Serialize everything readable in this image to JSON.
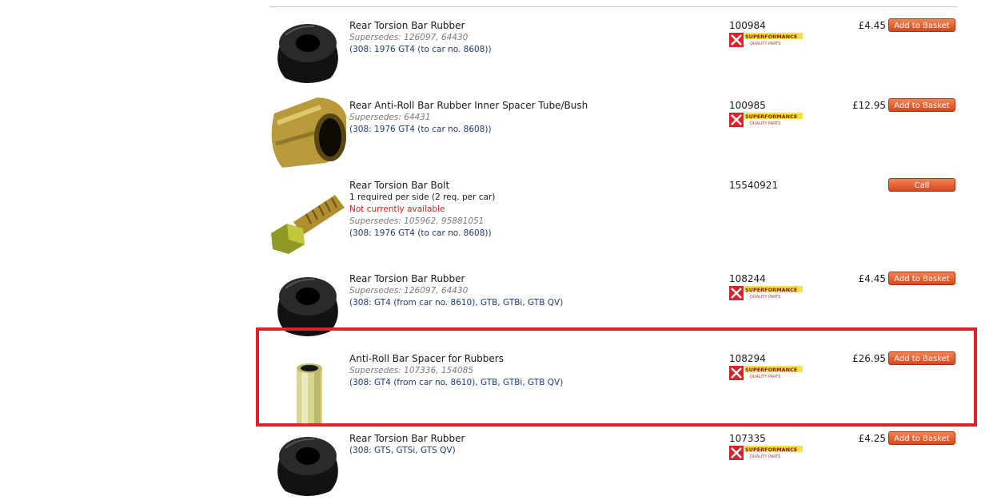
{
  "colors": {
    "accent_button": "#e05a26",
    "highlight_border": "#e2202a",
    "link": "#1f3a78",
    "unavailable": "#d31f1f"
  },
  "brand_logo": {
    "name": "SUPERFORMANCE",
    "tagline": "QUALITY PARTS"
  },
  "rows": [
    {
      "title": "Rear Torsion Bar Rubber",
      "image": "black-rubber-bushing",
      "supersedes": "Supersedes: 126097, 64430",
      "fitment": "(308: 1976 GT4 (to car no. 8608))",
      "part_no": "100984",
      "price": "£4.45",
      "button": "Add to Basket"
    },
    {
      "title": "Rear Anti-Roll Bar Rubber Inner Spacer Tube/Bush",
      "image": "brass-spacer-tube",
      "supersedes": "Supersedes: 64431",
      "fitment": "(308: 1976 GT4 (to car no. 8608))",
      "part_no": "100985",
      "price": "£12.95",
      "button": "Add to Basket"
    },
    {
      "title": "Rear Torsion Bar Bolt",
      "image": "hex-bolt",
      "note": "1 required per side (2 req. per car)",
      "availability": "Not currently available",
      "supersedes": "Supersedes: 105962, 95881051",
      "fitment": "(308: 1976 GT4 (to car no. 8608))",
      "part_no": "15540921",
      "button": "Call"
    },
    {
      "title": "Rear Torsion Bar Rubber",
      "image": "black-rubber-bushing",
      "supersedes": "Supersedes: 126097, 64430",
      "fitment": "(308: GT4 (from car no. 8610), GTB, GTBi, GTB QV)",
      "part_no": "108244",
      "price": "£4.45",
      "button": "Add to Basket"
    },
    {
      "title": "Anti-Roll Bar Spacer for Rubbers",
      "image": "zinc-spacer-tube",
      "supersedes": "Supersedes: 107336, 154085",
      "fitment": "(308: GT4 (from car no. 8610), GTB, GTBi, GTB QV)",
      "part_no": "108294",
      "price": "£26.95",
      "button": "Add to Basket"
    },
    {
      "title": "Rear Torsion Bar Rubber",
      "image": "black-rubber-bushing",
      "fitment": "(308: GTS, GTSi, GTS QV)",
      "part_no": "107335",
      "price": "£4.25",
      "button": "Add to Basket"
    }
  ]
}
